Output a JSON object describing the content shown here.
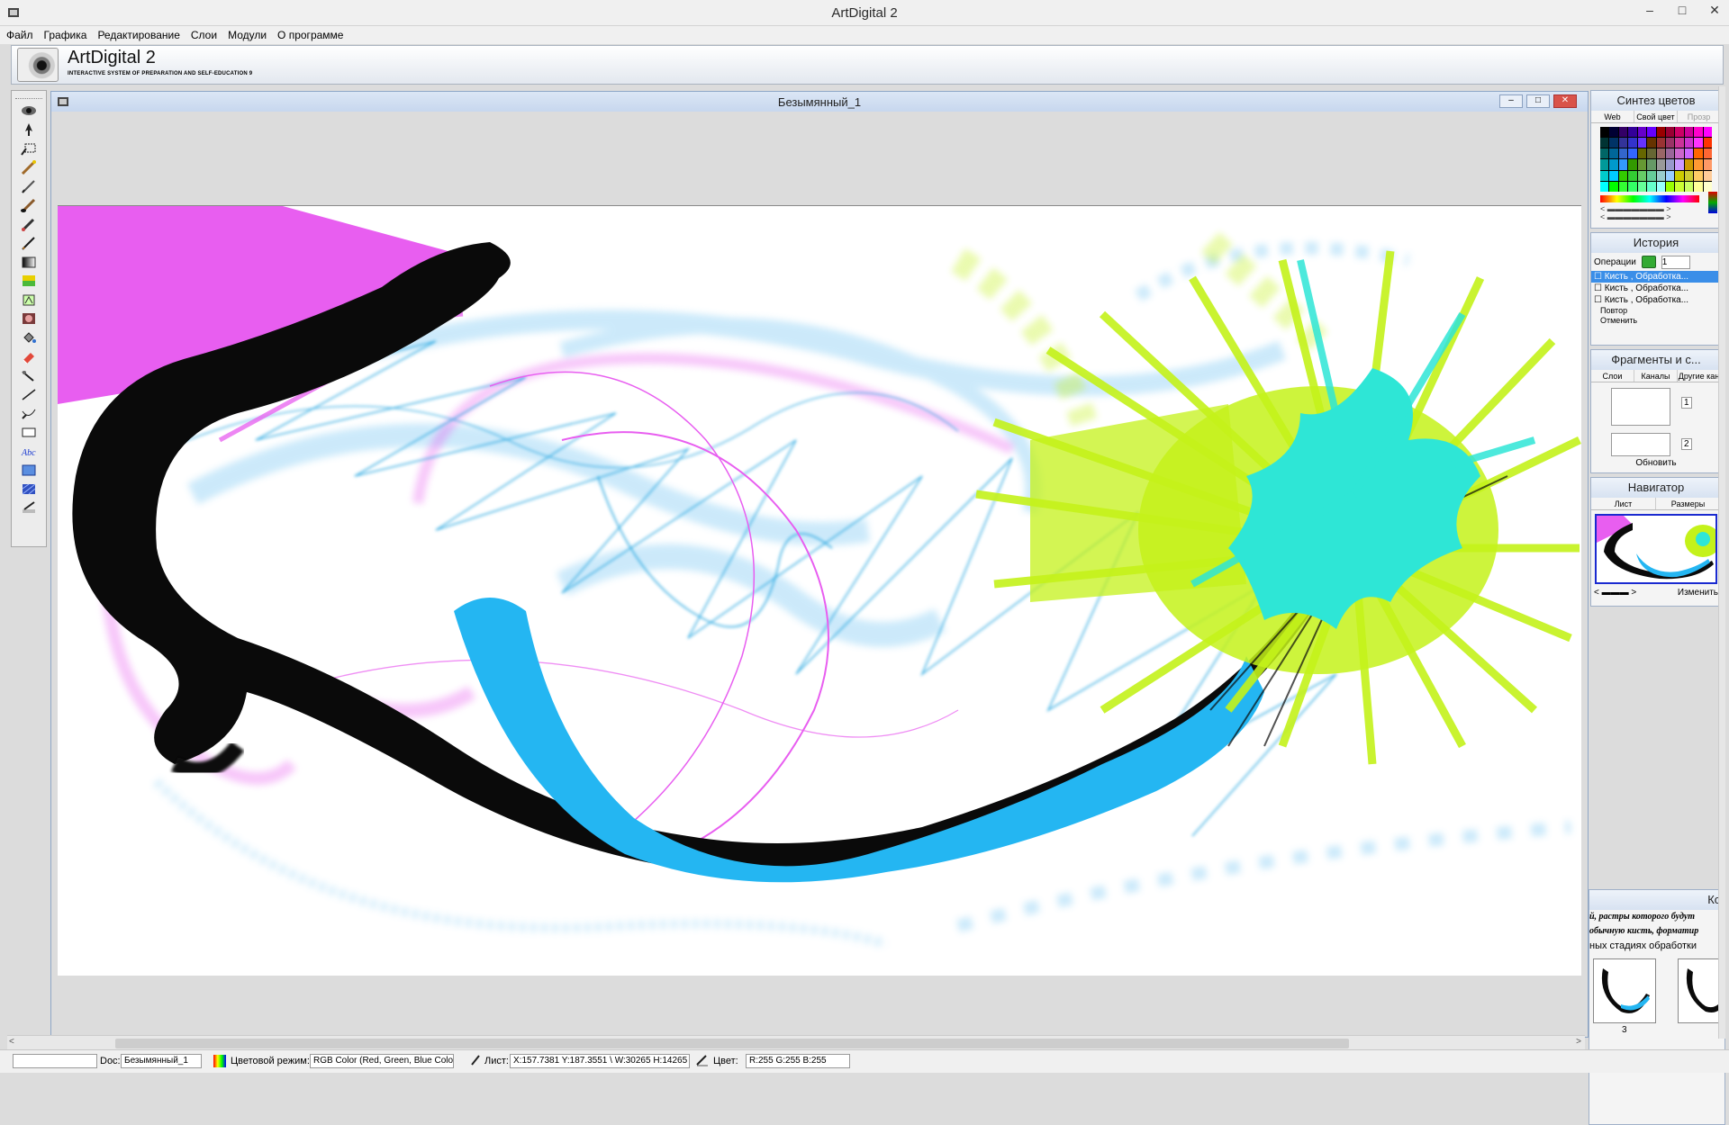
{
  "window": {
    "title": "ArtDigital 2",
    "min": "–",
    "max": "□",
    "close": "✕"
  },
  "menu": [
    "Файл",
    "Графика",
    "Редактирование",
    "Слои",
    "Модули",
    "О программе"
  ],
  "brand": {
    "name": "ArtDigital 2",
    "subtitle": "INTERACTIVE SYSTEM OF PREPARATION AND SELF-EDUCATION 9"
  },
  "document": {
    "title": "Безымянный_1"
  },
  "tools": [
    "selector-icon",
    "move-icon",
    "marquee-icon",
    "magic-wand-icon",
    "pencil-icon",
    "brush-icon",
    "airbrush-icon",
    "pen-icon",
    "gradient-icon",
    "color-swatch-icon",
    "stamp-icon",
    "blur-icon",
    "fill-icon",
    "eraser-icon",
    "smudge-icon",
    "line-icon",
    "path-icon",
    "rectangle-icon",
    "text-icon",
    "layer-icon",
    "pattern-icon",
    "edit-icon"
  ],
  "panels": {
    "color": {
      "title": "Синтез цветов",
      "tabs": [
        "Web",
        "Свой цвет",
        "Прозр"
      ]
    },
    "history": {
      "title": "История",
      "ops_label": "Операции",
      "ops_value": "1",
      "items": [
        "Кисть , Обработка...",
        "Кисть , Обработка...",
        "Кисть , Обработка..."
      ],
      "redo": "Повтор",
      "undo": "Отменить"
    },
    "fragments": {
      "title": "Фрагменты и с...",
      "tabs": [
        "Слои",
        "Каналы",
        "Другие кан"
      ],
      "slots": [
        "1",
        "2"
      ],
      "refresh": "Обновить"
    },
    "navigator": {
      "title": "Навигатор",
      "tabs": [
        "Лист",
        "Размеры"
      ],
      "change": "Изменить"
    },
    "comments": {
      "title": "Ко",
      "line1": "й, растры которого будут",
      "line2": "обычную кисть, форматир",
      "line3": "ных стадиях обработки",
      "thumb_label": "3"
    }
  },
  "status": {
    "doc_label": "Doc:",
    "doc_value": "Безымянный_1",
    "mode_label": "Цветовой режим:",
    "mode_value": "RGB Color (Red, Green, Blue Color)",
    "sheet_label": "Лист:",
    "sheet_value": "X:157.7381 Y:187.3551 \\ W:30265 H:14265",
    "color_label": "Цвет:",
    "color_value": "R:255 G:255 B:255"
  },
  "colors": {
    "magenta": "#e85ef0",
    "cyan": "#24b6f2",
    "lime": "#c4f21a",
    "teal": "#2ee6d6",
    "lightblue": "#8fd0f5",
    "black": "#0a0a0a"
  }
}
